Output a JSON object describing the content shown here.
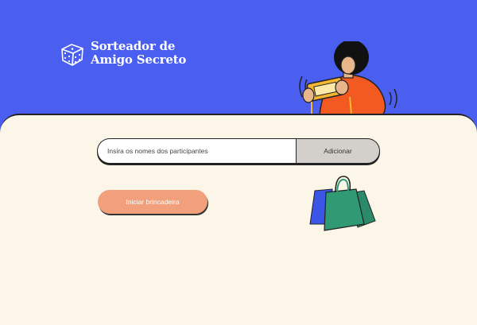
{
  "header": {
    "title_line1": "Sorteador de",
    "title_line2": "Amigo Secreto"
  },
  "form": {
    "placeholder": "Insira os nomes dos participantes",
    "add_label": "Adicionar",
    "start_label": "Iniciar brincadeira"
  },
  "colors": {
    "header_bg": "#4a5ef0",
    "panel_bg": "#fbf6e8",
    "start_button": "#f29f7c",
    "add_button": "#d3d0cb"
  },
  "icons": [
    "dice-icon",
    "person-illustration",
    "shopping-bags-illustration"
  ]
}
